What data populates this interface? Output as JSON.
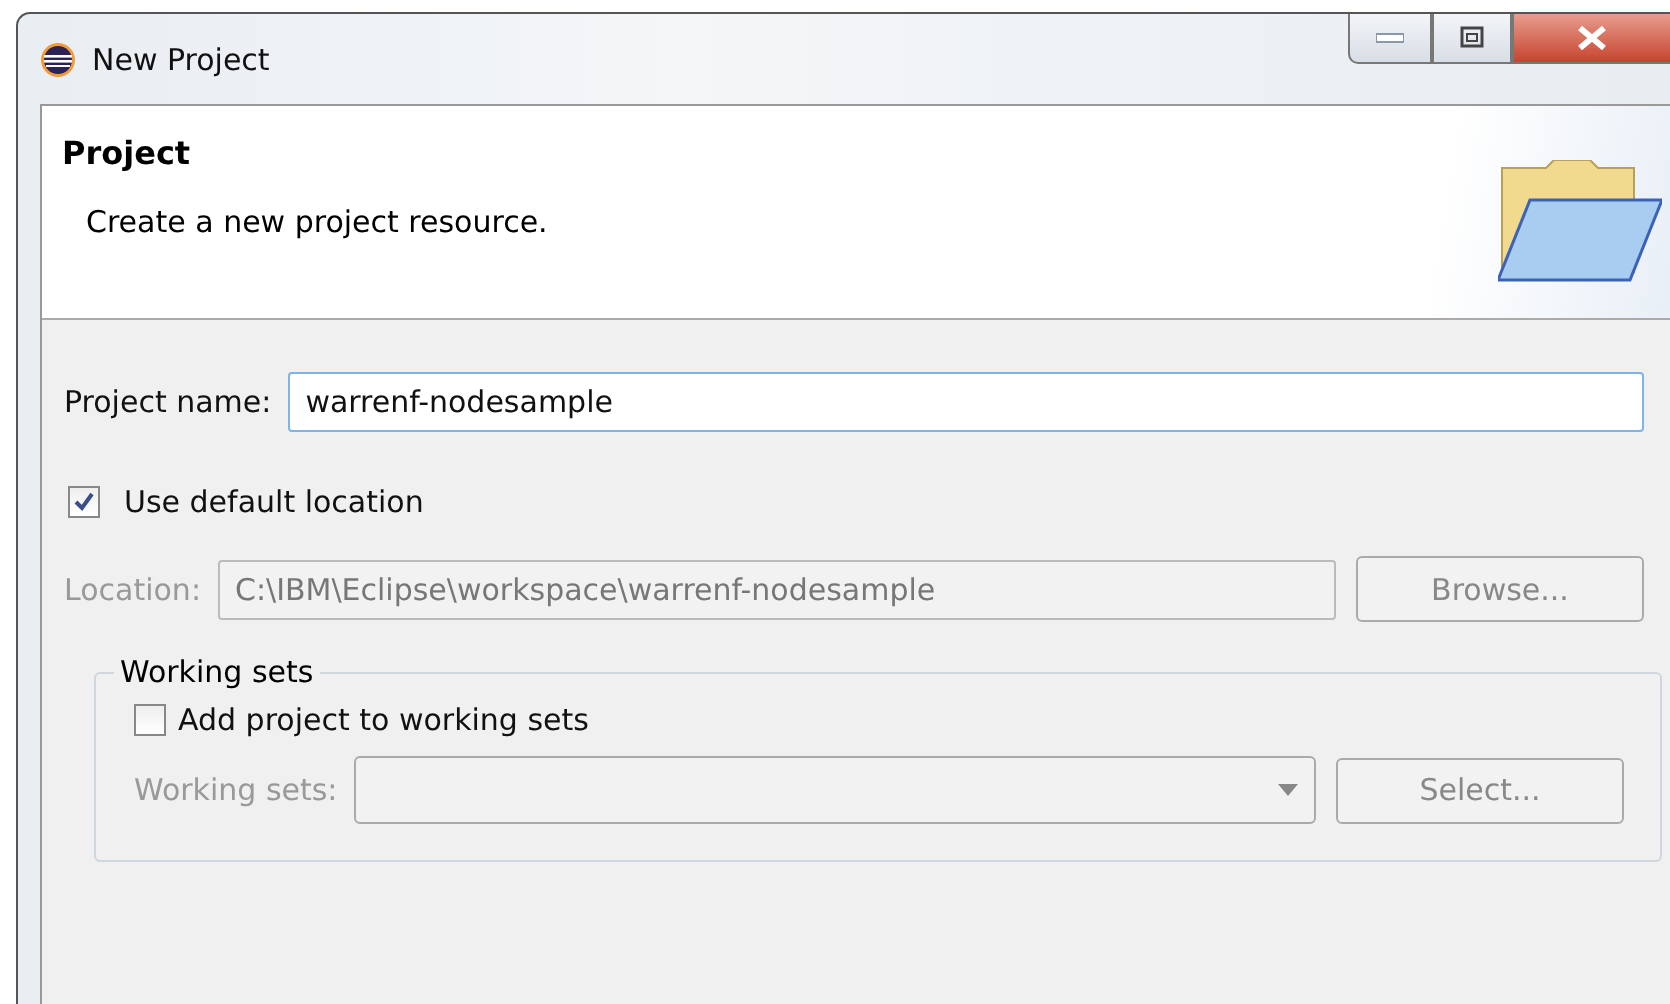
{
  "window": {
    "title": "New Project"
  },
  "header": {
    "title": "Project",
    "description": "Create a new project resource."
  },
  "project_name": {
    "label": "Project name:",
    "value": "warrenf-nodesample"
  },
  "use_default_location": {
    "label": "Use default location",
    "checked": true
  },
  "location": {
    "label": "Location:",
    "value": "C:\\IBM\\Eclipse\\workspace\\warrenf-nodesample",
    "disabled": true,
    "button": "Browse..."
  },
  "working_sets_group": {
    "title": "Working sets",
    "add_to_working_sets": {
      "label": "Add project to working sets",
      "checked": false
    },
    "working_sets": {
      "label": "Working sets:",
      "disabled": true,
      "button": "Select..."
    }
  }
}
